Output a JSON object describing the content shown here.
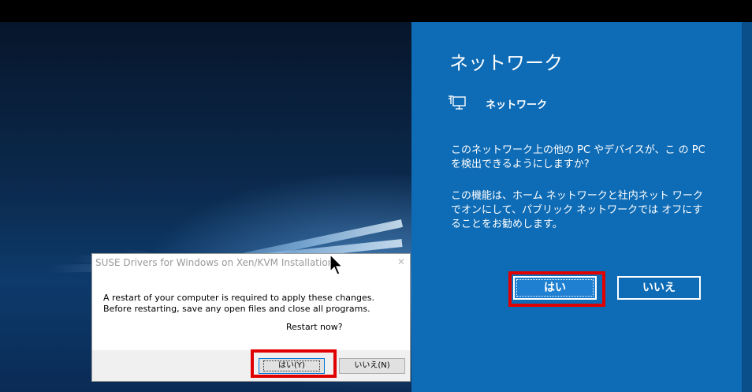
{
  "network_flyout": {
    "title": "ネットワーク",
    "network_name": "ネットワーク",
    "icon": "network-icon",
    "paragraph1": "このネットワーク上の他の PC やデバイスが、こ の PC を検出できるようにしますか?",
    "paragraph2": "この機能は、ホーム ネットワークと社内ネット ワークでオンにして、パブリック ネットワークでは オフにすることをお勧めします。",
    "yes_label": "はい",
    "no_label": "いいえ",
    "background_color": "#0e6bb5"
  },
  "installer_dialog": {
    "title": "SUSE Drivers for Windows on Xen/KVM Installation",
    "line1": "A restart of your computer is required to apply these changes.",
    "line2": "Before restarting, save any open files and close all programs.",
    "prompt": "Restart now?",
    "yes_label": "はい(Y)",
    "no_label": "いいえ(N)"
  },
  "highlight_color": "#e00000"
}
